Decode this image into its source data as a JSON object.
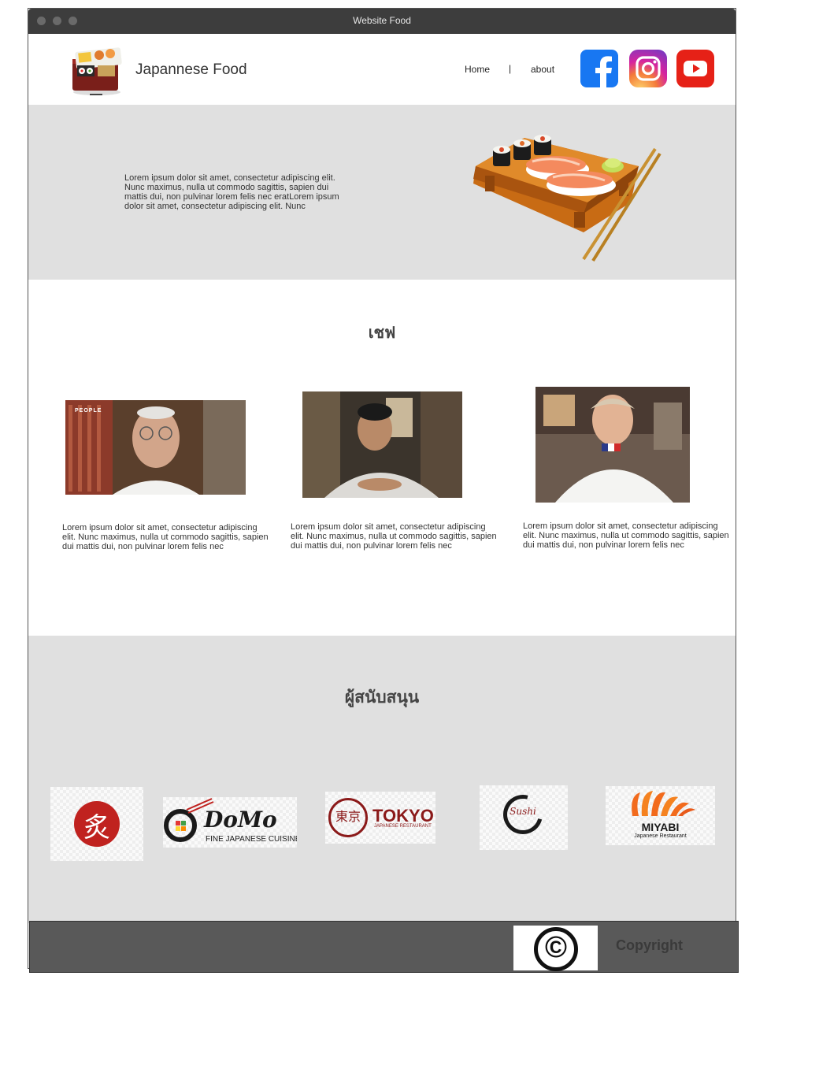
{
  "window": {
    "title": "Website Food"
  },
  "header": {
    "brand": "Japannese Food",
    "nav": {
      "home": "Home",
      "separator": "|",
      "about": "about"
    },
    "social": [
      {
        "name": "facebook",
        "icon": "facebook-icon",
        "color": "#1877f2"
      },
      {
        "name": "instagram",
        "icon": "instagram-icon",
        "color": "#d6249f"
      },
      {
        "name": "youtube",
        "icon": "youtube-icon",
        "color": "#e62117"
      }
    ]
  },
  "hero": {
    "text": "Lorem ipsum dolor sit amet, consectetur adipiscing elit. Nunc maximus, nulla ut commodo sagittis, sapien dui mattis dui, non pulvinar lorem felis nec eratLorem ipsum dolor sit amet, consectetur adipiscing elit. Nunc"
  },
  "chefs": {
    "title": "เชฟ",
    "items": [
      {
        "text": "Lorem ipsum dolor sit amet, consectetur adipiscing elit. Nunc maximus, nulla ut commodo sagittis, sapien dui mattis dui, non pulvinar lorem felis nec",
        "badge": "PEOPLE"
      },
      {
        "text": "Lorem ipsum dolor sit amet, consectetur adipiscing elit. Nunc maximus, nulla ut commodo sagittis, sapien dui mattis dui, non pulvinar lorem felis nec"
      },
      {
        "text": "Lorem ipsum dolor sit amet, consectetur adipiscing elit. Nunc maximus, nulla ut commodo sagittis, sapien dui mattis dui, non pulvinar lorem felis nec"
      }
    ]
  },
  "sponsors": {
    "title": "ผู้สนับสนุน",
    "logos": [
      {
        "glyph": "炙"
      },
      {
        "name": "DoMo",
        "subtitle": "FINE JAPANESE CUISINE"
      },
      {
        "glyph": "東京",
        "name": "TOKYO",
        "subtitle": "JAPANESE RESTAURANT"
      },
      {
        "name": "Sushi"
      },
      {
        "name": "MIYABI",
        "subtitle": "Japanese Restaurant"
      }
    ]
  },
  "footer": {
    "symbol": "©",
    "copyright": "Copyright"
  },
  "colors": {
    "titlebar": "#3d3d3d",
    "section_bg": "#e0e0e0",
    "footer_bg": "#595959",
    "sponsor_red": "#c0221f",
    "tokyo_red": "#8b1a1a",
    "miyabi_orange": "#f26b1d"
  }
}
